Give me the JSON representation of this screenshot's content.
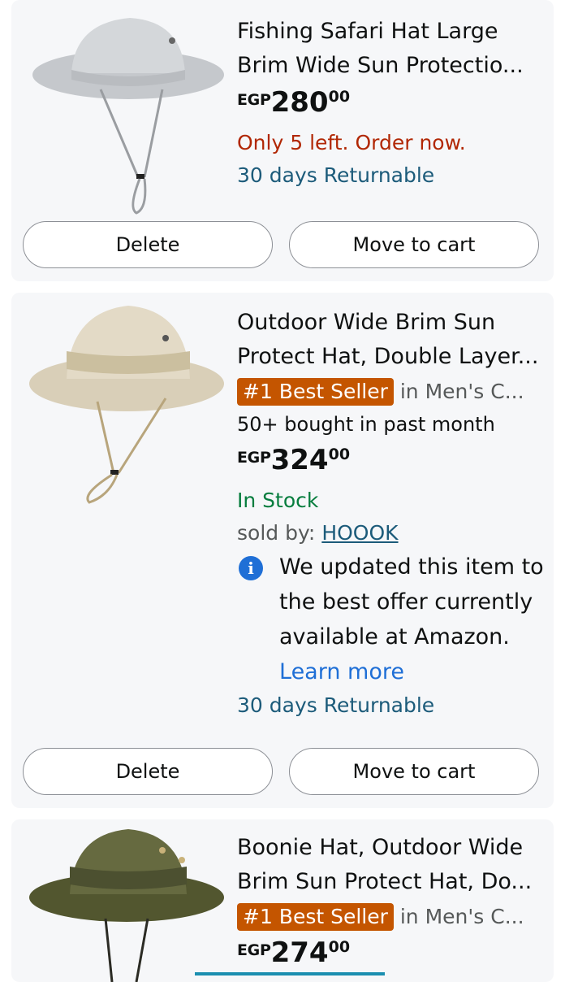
{
  "items": [
    {
      "title": "Fishing Safari Hat Large Brim Wide Sun Protectio...",
      "price": {
        "currency": "EGP",
        "whole": "280",
        "fraction": "00"
      },
      "availability": "Only 5 left. Order now.",
      "returnable": "30 days Returnable",
      "delete_label": "Delete",
      "move_label": "Move to cart",
      "hat_color": "#c9ccd0"
    },
    {
      "title": "Outdoor Wide Brim Sun Protect Hat, Double Layer...",
      "badge": "#1 Best Seller",
      "category": "in Men's C...",
      "bought": "50+ bought in past month",
      "price": {
        "currency": "EGP",
        "whole": "324",
        "fraction": "00"
      },
      "availability": "In Stock",
      "sold_by_label": "sold by:",
      "seller": "HOOOK",
      "notice": "We updated this item to the best offer currently available at Amazon.",
      "learn_more": "Learn more",
      "returnable": "30 days Returnable",
      "delete_label": "Delete",
      "move_label": "Move to cart",
      "hat_color": "#ddd3bd"
    },
    {
      "title": "Boonie Hat, Outdoor Wide Brim Sun Protect Hat, Do...",
      "badge": "#1 Best Seller",
      "category": "in Men's C...",
      "price": {
        "currency": "EGP",
        "whole": "274",
        "fraction": "00"
      },
      "hat_color": "#5b5f3c"
    }
  ],
  "icons": {
    "info": "info-icon"
  },
  "colors": {
    "badge": "#c45500",
    "price_red": "#b12704",
    "link_teal": "#1c5b7a",
    "in_stock": "#067d3e"
  }
}
